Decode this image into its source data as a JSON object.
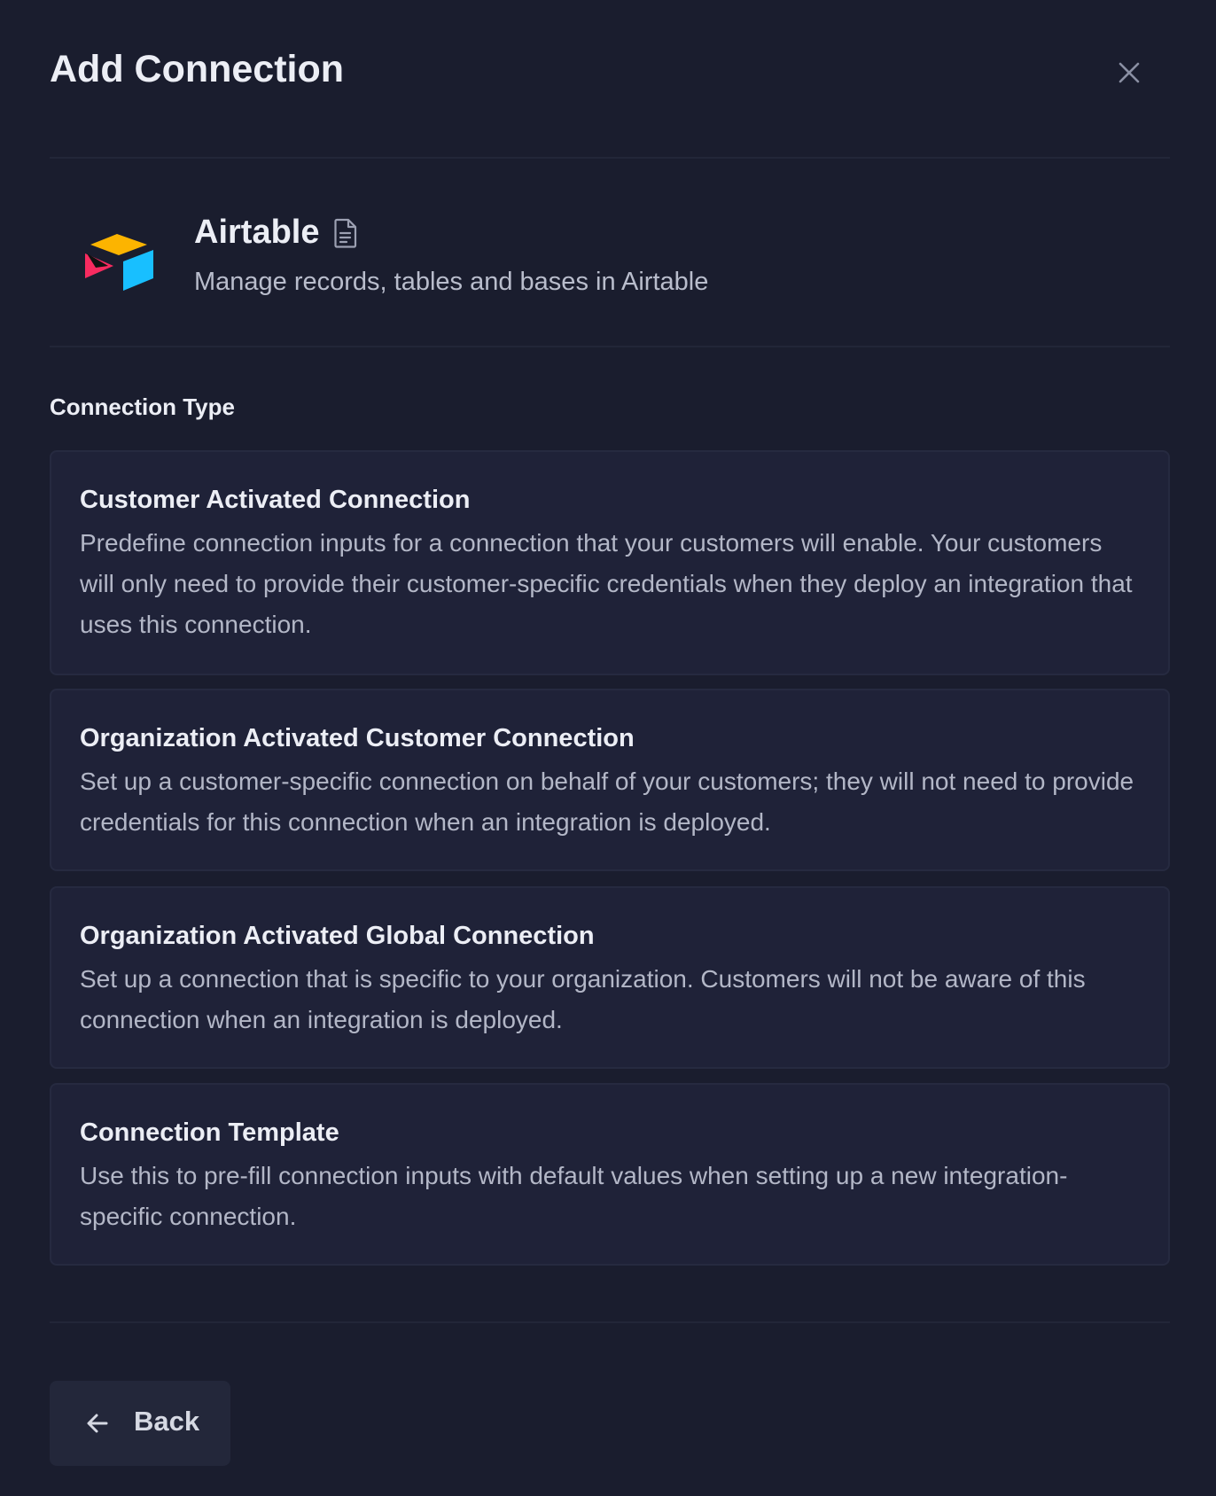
{
  "modal": {
    "title": "Add Connection",
    "close_icon": "close-icon"
  },
  "app": {
    "name": "Airtable",
    "description": "Manage records, tables and bases in Airtable",
    "logo_icon": "airtable-logo",
    "doc_icon": "document-icon",
    "logo_colors": {
      "yellow": "#fcb400",
      "blue": "#18bfff",
      "red": "#f82b60",
      "dark": "#000000"
    }
  },
  "section": {
    "label": "Connection Type"
  },
  "options": [
    {
      "title": "Customer Activated Connection",
      "description": "Predefine connection inputs for a connection that your customers will enable. Your customers will only need to provide their customer-specific credentials when they deploy an integration that uses this connection."
    },
    {
      "title": "Organization Activated Customer Connection",
      "description": "Set up a customer-specific connection on behalf of your customers; they will not need to provide credentials for this connection when an integration is deployed."
    },
    {
      "title": "Organization Activated Global Connection",
      "description": "Set up a connection that is specific to your organization. Customers will not be aware of this connection when an integration is deployed."
    },
    {
      "title": "Connection Template",
      "description": "Use this to pre-fill connection inputs with default values when setting up a new integration-specific connection."
    }
  ],
  "footer": {
    "back_label": "Back",
    "back_icon": "arrow-left-icon"
  },
  "colors": {
    "background": "#1a1d2e",
    "card": "#1f2238",
    "card_border": "#262a40",
    "button": "#23273a",
    "text_primary": "#eceef5",
    "text_secondary": "#b3b7c7"
  }
}
